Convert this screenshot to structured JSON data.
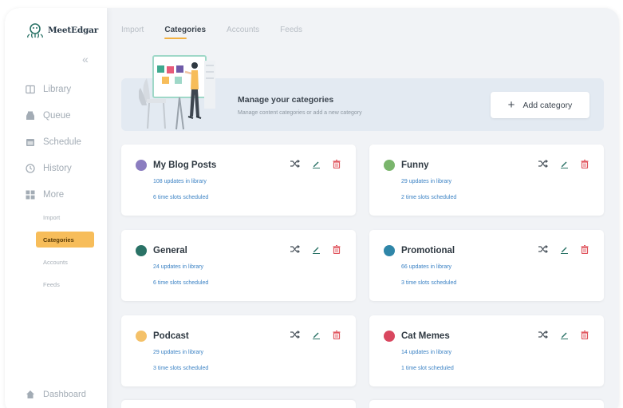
{
  "sidebar": {
    "logo": "MeetEdgar",
    "nav": [
      "Library",
      "Queue",
      "Schedule",
      "History",
      "More"
    ],
    "sub": [
      "Import",
      "Categories",
      "Accounts",
      "Feeds"
    ],
    "dashboard": "Dashboard"
  },
  "tabs": [
    "Import",
    "Categories",
    "Accounts",
    "Feeds"
  ],
  "banner": {
    "title": "Manage your categories",
    "subtitle": "Manage content categories or add a new category",
    "add_button": "Add category"
  },
  "categories": [
    {
      "name": "My Blog Posts",
      "updates": "108 updates in library",
      "slots": "6 time slots scheduled",
      "color": "#8b7dc0"
    },
    {
      "name": "Funny",
      "updates": "29 updates in library",
      "slots": "2 time slots scheduled",
      "color": "#7ab56c"
    },
    {
      "name": "General",
      "updates": "24 updates in library",
      "slots": "6 time slots scheduled",
      "color": "#2a7266"
    },
    {
      "name": "Promotional",
      "updates": "66 updates in library",
      "slots": "3 time slots scheduled",
      "color": "#2f86a8"
    },
    {
      "name": "Podcast",
      "updates": "29 updates in library",
      "slots": "3 time slots scheduled",
      "color": "#f4c169"
    },
    {
      "name": "Cat Memes",
      "updates": "14 updates in library",
      "slots": "1 time slot scheduled",
      "color": "#d9475f"
    }
  ],
  "colors": {
    "accent": "#f7bd5a",
    "link": "#3b82c4",
    "edit": "#2a7266",
    "delete": "#e0545d"
  },
  "icons": [
    "shuffle-icon",
    "edit-icon",
    "trash-icon"
  ]
}
